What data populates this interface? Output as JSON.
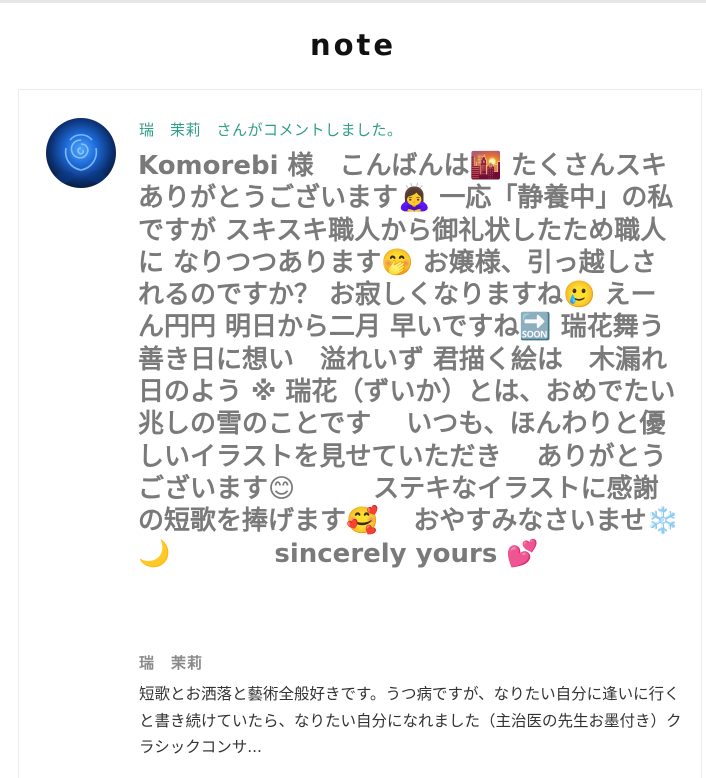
{
  "header": {
    "logo_text": "note"
  },
  "notification": {
    "commenter_name": "瑞　茉莉",
    "action_text": "　さんがコメントしました。"
  },
  "comment": {
    "body": "Komorebi 様　こんばんは🌇 たくさんスキありがとうございます🙇‍♀️ 一応「静養中」の私ですが スキスキ職人から御礼状したため職人に なりつつあります🤭 お嬢様、引っ越しされるのですか？ お寂しくなりますね🥲 えーん円円 明日から二月 早いですね🔜 瑞花舞う　善き日に想い　溢れいず 君描く絵は　木漏れ日のよう ※ 瑞花（ずいか）とは、おめでたい兆しの雪のことです　 いつも、ほんわりと優しいイラストを見せていただき　 ありがとうございます😊　　　ステキなイラストに感謝の短歌を捧げます🥰　 おやすみなさいませ❄️ 🌙　　　　sincerely yours 💕"
  },
  "author": {
    "name": "瑞　茉莉",
    "bio": "短歌とお洒落と藝術全般好きです。うつ病ですが、なりたい自分に逢いに行くと書き続けていたら、なりたい自分になれました（主治医の先生お墨付き）クラシックコンサ..."
  }
}
